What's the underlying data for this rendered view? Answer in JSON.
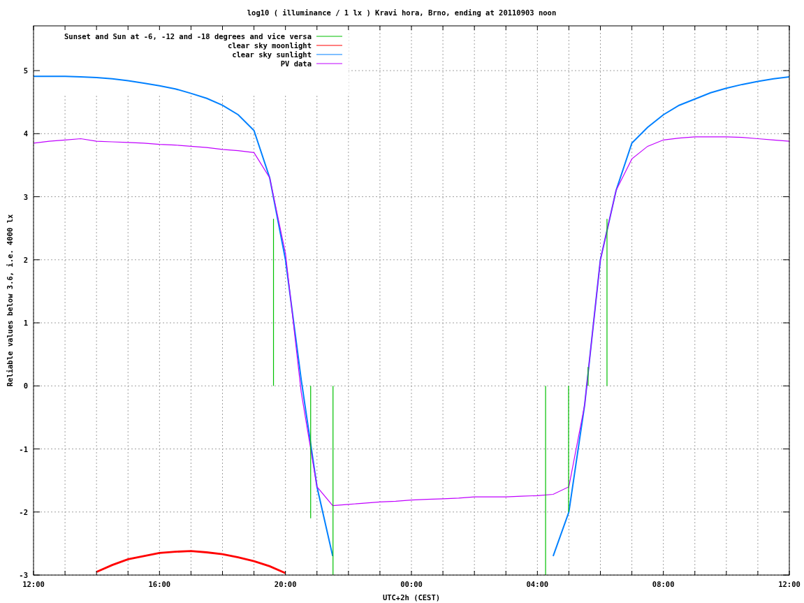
{
  "plot": {
    "chart_data": {
      "type": "line",
      "title": "log10 ( illuminance / 1 lx ) Kravi hora, Brno, ending at 20110903 noon",
      "xlabel": "UTC+2h (CEST)",
      "ylabel": "Reliable values below 3.6, i.e. 4000 lx",
      "categories": [
        "12:00",
        null,
        null,
        null,
        null,
        null,
        null,
        null,
        "16:00",
        null,
        null,
        null,
        null,
        null,
        null,
        null,
        "20:00",
        null,
        null,
        null,
        null,
        null,
        null,
        null,
        "00:00",
        null,
        null,
        null,
        null,
        null,
        null,
        null,
        "04:00",
        null,
        null,
        null,
        null,
        null,
        null,
        null,
        "08:00",
        null,
        null,
        null,
        null,
        null,
        null,
        null,
        "12:00"
      ],
      "series": [
        {
          "name": "Sunset and Sun at -6, -12 and -18 degrees and vice versa",
          "color": "#00c000",
          "values": [
            null,
            null,
            null,
            null,
            null,
            null,
            null,
            null,
            null,
            null,
            null,
            null,
            null,
            null,
            null,
            null,
            null,
            null,
            null,
            null,
            null,
            null,
            null,
            null,
            null,
            null,
            null,
            null,
            null,
            null,
            null,
            null,
            null,
            null,
            null,
            null,
            null,
            null,
            null,
            null,
            null,
            null,
            null,
            null,
            null,
            null,
            null,
            null,
            null
          ]
        },
        {
          "name": "clear sky moonlight",
          "color": "#ff0000",
          "values": [
            null,
            null,
            null,
            null,
            -2.95,
            -2.84,
            -2.75,
            -2.7,
            -2.65,
            -2.63,
            -2.62,
            -2.64,
            -2.67,
            -2.72,
            -2.78,
            -2.86,
            -2.97,
            null,
            null,
            null,
            null,
            null,
            null,
            null,
            null,
            null,
            null,
            null,
            null,
            null,
            null,
            null,
            null,
            null,
            null,
            null,
            null,
            null,
            null,
            null,
            null,
            null,
            null,
            null,
            null,
            null,
            null,
            null,
            null
          ]
        },
        {
          "name": "clear sky sunlight",
          "color": "#0080ff",
          "values": [
            4.91,
            4.91,
            4.91,
            4.9,
            4.89,
            4.87,
            4.84,
            4.8,
            4.76,
            4.71,
            4.64,
            4.56,
            4.45,
            4.3,
            4.05,
            3.3,
            2.0,
            0.1,
            -1.6,
            -2.7,
            null,
            null,
            null,
            null,
            null,
            null,
            null,
            null,
            null,
            null,
            null,
            null,
            null,
            -2.7,
            -2.0,
            -0.3,
            2.0,
            3.1,
            3.85,
            4.1,
            4.3,
            4.45,
            4.55,
            4.65,
            4.72,
            4.78,
            4.83,
            4.87,
            4.9
          ]
        },
        {
          "name": "PV data",
          "color": "#c000ff",
          "values": [
            3.85,
            3.88,
            3.9,
            3.92,
            3.88,
            3.87,
            3.86,
            3.85,
            3.83,
            3.82,
            3.8,
            3.78,
            3.75,
            3.73,
            3.7,
            3.3,
            2.1,
            -0.1,
            -1.6,
            -1.9,
            -1.88,
            -1.86,
            -1.84,
            -1.83,
            -1.81,
            -1.8,
            -1.79,
            -1.78,
            -1.76,
            -1.76,
            -1.76,
            -1.75,
            -1.74,
            -1.72,
            -1.6,
            -0.3,
            2.0,
            3.1,
            3.6,
            3.8,
            3.9,
            3.93,
            3.95,
            3.95,
            3.95,
            3.94,
            3.92,
            3.9,
            3.88
          ]
        }
      ],
      "ylim": [
        -3,
        5.71
      ],
      "grid": true,
      "legend": true,
      "yticks": [
        -3,
        -2,
        -1,
        0,
        1,
        2,
        3,
        4,
        5
      ]
    }
  }
}
